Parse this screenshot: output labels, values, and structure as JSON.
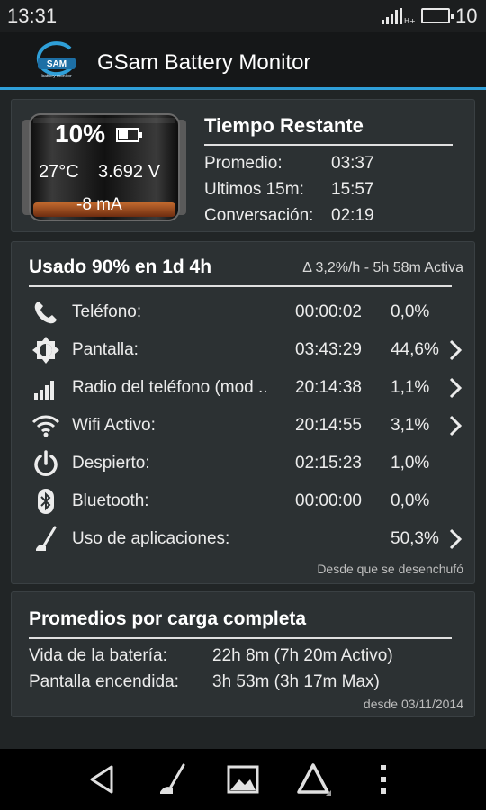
{
  "status_bar": {
    "time": "13:31",
    "battery_level": "10"
  },
  "app": {
    "title": "GSam Battery Monitor",
    "logo_text": "SAM",
    "logo_subtext": "battery monitor"
  },
  "battery": {
    "percent": "10%",
    "temperature": "27°C",
    "voltage": "3.692 V",
    "current": "-8 mA",
    "fill_fraction": 0.1
  },
  "time_remaining": {
    "title": "Tiempo Restante",
    "rows": [
      {
        "label": "Promedio:",
        "value": "03:37"
      },
      {
        "label": "Ultimos 15m:",
        "value": "15:57"
      },
      {
        "label": "Conversación:",
        "value": "02:19"
      }
    ]
  },
  "usage": {
    "title": "Usado 90% en 1d 4h",
    "rate": "Δ 3,2%/h - 5h 58m Activa",
    "rows": [
      {
        "icon": "phone-icon",
        "label": "Teléfono:",
        "time": "00:00:02",
        "percent": "0,0%",
        "has_chevron": false
      },
      {
        "icon": "brightness-icon",
        "label": "Pantalla:",
        "time": "03:43:29",
        "percent": "44,6%",
        "has_chevron": true
      },
      {
        "icon": "signal-bars-icon",
        "label": "Radio del teléfono (mod ..",
        "time": "20:14:38",
        "percent": "1,1%",
        "has_chevron": true
      },
      {
        "icon": "wifi-icon",
        "label": "Wifi Activo:",
        "time": "20:14:55",
        "percent": "3,1%",
        "has_chevron": true
      },
      {
        "icon": "power-icon",
        "label": "Despierto:",
        "time": "02:15:23",
        "percent": "1,0%",
        "has_chevron": false
      },
      {
        "icon": "bluetooth-icon",
        "label": "Bluetooth:",
        "time": "00:00:00",
        "percent": "0,0%",
        "has_chevron": false
      },
      {
        "icon": "app-usage-icon",
        "label": "Uso de aplicaciones:",
        "time": "",
        "percent": "50,3%",
        "has_chevron": true
      }
    ],
    "since": "Desde que se desenchufó"
  },
  "averages": {
    "title": "Promedios por carga completa",
    "rows": [
      {
        "label": "Vida de la batería:",
        "value": "22h 8m (7h 20m Activo)"
      },
      {
        "label": "Pantalla encendida:",
        "value": "3h 53m (3h 17m Max)"
      }
    ],
    "since": "desde 03/11/2014"
  },
  "navigation": {
    "items": [
      "back-icon",
      "app-usage-icon",
      "image-icon",
      "delta-icon",
      "overflow-menu-icon"
    ]
  },
  "colors": {
    "accent": "#2f9fd8",
    "card_bg": "#2c3133",
    "page_bg": "#212526",
    "battery_fill": "#a24a1e"
  }
}
